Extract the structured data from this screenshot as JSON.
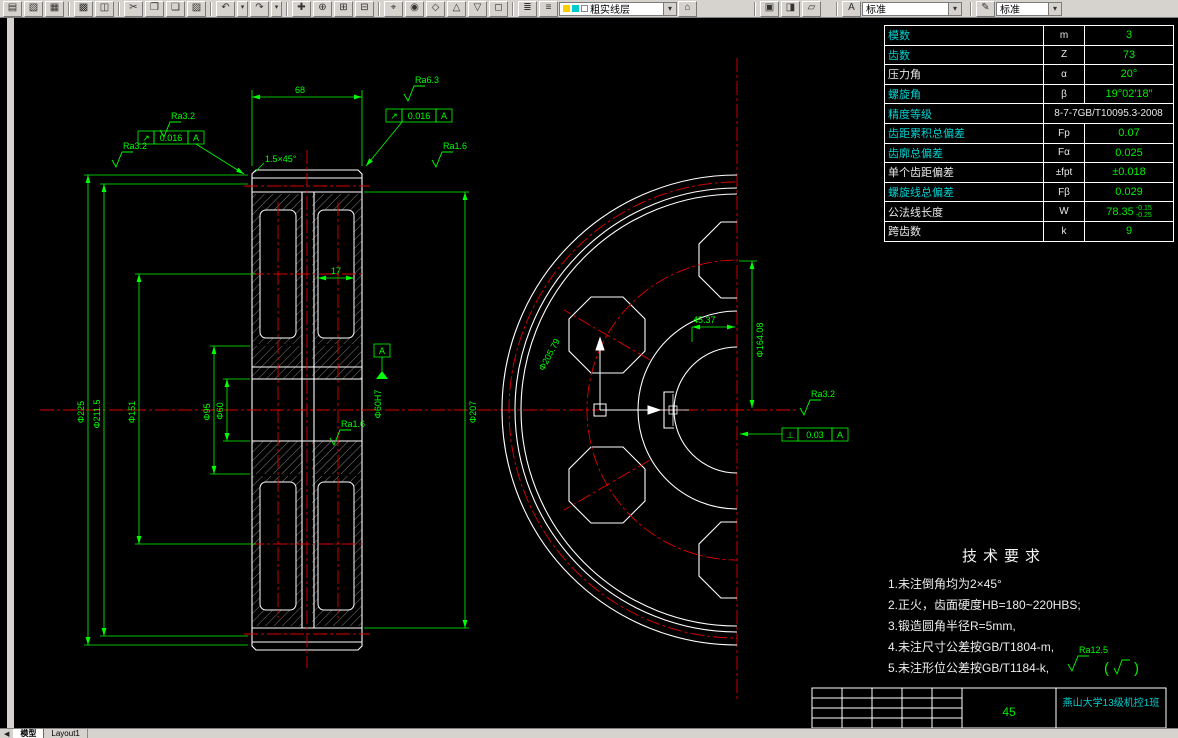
{
  "toolbar": {
    "new_glyph": "▤",
    "open_glyph": "▧",
    "save_glyph": "▦",
    "plot_glyph": "▩",
    "preview_glyph": "◫",
    "cut_glyph": "✂",
    "copy_glyph": "❐",
    "paste_glyph": "❏",
    "match_glyph": "▨",
    "undo_glyph": "↶",
    "redo_glyph": "↷",
    "drop_glyph": "▾",
    "pan_glyph": "✚",
    "zoom_rt_glyph": "⊕",
    "zoom_win_glyph": "⊞",
    "zoom_prev_glyph": "⊟",
    "target_glyph": "⌖",
    "circle_glyph": "◉",
    "diamond_glyph": "◇",
    "tri_up_glyph": "△",
    "tri_down_glyph": "▽",
    "square_glyph": "◻",
    "layers_glyph": "≣",
    "layerprops_glyph": "≡",
    "makelayer_glyph": "⌂",
    "designcenter_glyph": "▣",
    "properties_glyph": "◨",
    "palettes_glyph": "▱",
    "textstyle_glyph": "A",
    "dimstyle_glyph": "✎",
    "layer_value": "粗实线层",
    "text_style_value": "标准",
    "dim_style_value": "标准"
  },
  "tabs": {
    "nav": "◀",
    "model": "模型",
    "layout1": "Layout1"
  },
  "param_table": {
    "rows": [
      {
        "label": "模数",
        "sym": "m",
        "val": "3"
      },
      {
        "label": "齿数",
        "sym": "Z",
        "val": "73"
      },
      {
        "label": "压力角",
        "sym": "α",
        "val": "20°"
      },
      {
        "label": "螺旋角",
        "sym": "β",
        "val": "19°02′18″"
      },
      {
        "label": "精度等级",
        "sym": "",
        "val": "8-7-7GB/T10095.3-2008"
      },
      {
        "label": "齿距累积总偏差",
        "sym": "Fp",
        "val": "0.07"
      },
      {
        "label": "齿廓总偏差",
        "sym": "Fα",
        "val": "0.025"
      },
      {
        "label": "单个齿距偏差",
        "sym": "±fpt",
        "val": "±0.018"
      },
      {
        "label": "螺旋线总偏差",
        "sym": "Fβ",
        "val": "0.029"
      },
      {
        "label": "公法线长度",
        "sym": "W",
        "val": "78.35",
        "val_sup": "-0.15",
        "val_sub": "-0.25"
      },
      {
        "label": "跨齿数",
        "sym": "k",
        "val": "9"
      }
    ]
  },
  "tech": {
    "title": "技术要求",
    "items": [
      "1.未注倒角均为2×45°",
      "2.正火，齿面硬度HB=180~220HBS;",
      "3.锻造圆角半径R=5mm,",
      "4.未注尺寸公差按GB/T1804-m,",
      "5.未注形位公差按GB/T1184-k,"
    ],
    "other_open": "(",
    "other_close": ")"
  },
  "title_block": {
    "mid": "45",
    "school": "燕山大学13级机控1班"
  },
  "drawing": {
    "dims": {
      "width": "68",
      "chamfer": "1.5×45°",
      "od": "Φ225",
      "root": "Φ211.5",
      "hole_circle": "Φ151",
      "hub": "Φ95",
      "bore": "Φ60",
      "rim_inner": "Φ207",
      "hole_width": "17",
      "bore_fit": "Φ60H7",
      "hole_dia": "45.37",
      "hole_circle_front": "Φ164.08",
      "base_circle": "Φ205.79"
    },
    "sf": {
      "ra32": "Ra3.2",
      "ra63": "Ra6.3",
      "ra16": "Ra1.6",
      "ra125": "Ra12.5"
    },
    "frames": {
      "runout_sym": "↗",
      "runout_val": "0.016",
      "perp_sym": "⊥",
      "perp_val": "0.03",
      "datum": "A"
    },
    "colors": {
      "line": "#ffffff",
      "center": "#e00000",
      "dim": "#00ff00",
      "label": "#00d0d0",
      "value": "#00ee00"
    }
  }
}
